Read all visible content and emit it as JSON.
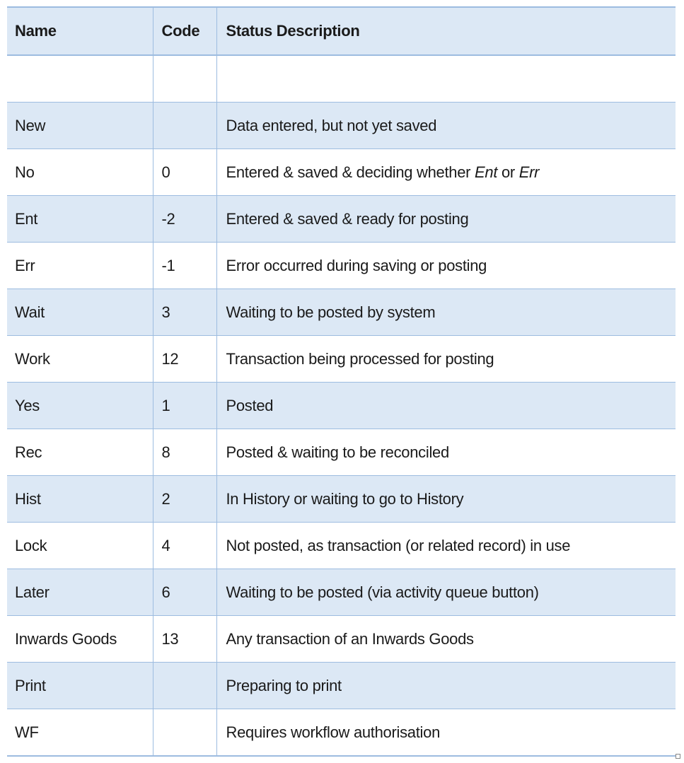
{
  "table": {
    "headers": [
      "Name",
      "Code",
      "Status Description"
    ],
    "rows": [
      {
        "name": "",
        "code": "",
        "desc": ""
      },
      {
        "name": "New",
        "code": "",
        "desc": "Data entered, but not yet saved"
      },
      {
        "name": "No",
        "code": "0",
        "desc_parts": [
          "Entered & saved & deciding whether ",
          "Ent",
          " or ",
          "Err"
        ]
      },
      {
        "name": "Ent",
        "code": "-2",
        "desc": "Entered & saved & ready for posting"
      },
      {
        "name": "Err",
        "code": "-1",
        "desc": "Error occurred during saving or posting"
      },
      {
        "name": "Wait",
        "code": "3",
        "desc": "Waiting to be posted by system"
      },
      {
        "name": "Work",
        "code": "12",
        "desc": "Transaction being processed for posting"
      },
      {
        "name": "Yes",
        "code": "1",
        "desc": "Posted"
      },
      {
        "name": "Rec",
        "code": "8",
        "desc": "Posted & waiting to be reconciled"
      },
      {
        "name": "Hist",
        "code": "2",
        "desc": "In History or waiting to go to History"
      },
      {
        "name": "Lock",
        "code": "4",
        "desc": "Not posted, as transaction (or related record) in use"
      },
      {
        "name": "Later",
        "code": "6",
        "desc": "Waiting to be posted (via activity queue button)"
      },
      {
        "name": "Inwards Goods",
        "code": "13",
        "desc": "Any transaction of an Inwards Goods"
      },
      {
        "name": "Print",
        "code": "",
        "desc": "Preparing to print"
      },
      {
        "name": "WF",
        "code": "",
        "desc": "Requires workflow authorisation"
      }
    ]
  },
  "colors": {
    "header_fill": "#dce8f5",
    "stripe_fill": "#dce8f5",
    "border": "#9dbce0"
  }
}
